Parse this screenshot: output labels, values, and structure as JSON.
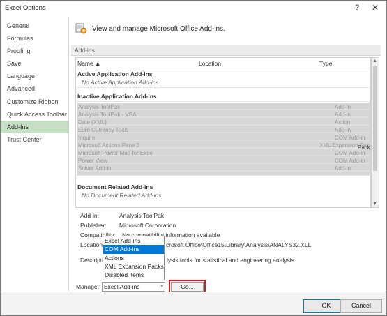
{
  "window": {
    "title": "Excel Options",
    "help": "?",
    "close": "✕"
  },
  "sidebar": {
    "items": [
      {
        "label": "General"
      },
      {
        "label": "Formulas"
      },
      {
        "label": "Proofing"
      },
      {
        "label": "Save"
      },
      {
        "label": "Language"
      },
      {
        "label": "Advanced"
      },
      {
        "label": "Customize Ribbon"
      },
      {
        "label": "Quick Access Toolbar"
      },
      {
        "label": "Add-Ins",
        "active": true
      },
      {
        "label": "Trust Center"
      }
    ]
  },
  "main": {
    "header": "View and manage Microsoft Office Add-ins.",
    "section": "Add-ins",
    "columns": {
      "name": "Name ▲",
      "location": "Location",
      "type": "Type"
    },
    "groups": {
      "active": "Active Application Add-ins",
      "active_empty": "No Active Application Add-ins",
      "inactive": "Inactive Application Add-ins",
      "document": "Document Related Add-ins",
      "document_empty": "No Document Related Add-ins"
    },
    "inactive_rows": [
      {
        "name": "Analysis ToolPak",
        "type": "Add-in"
      },
      {
        "name": "Analysis ToolPak - VBA",
        "type": "Add-in"
      },
      {
        "name": "Date (XML)",
        "type": "Action"
      },
      {
        "name": "Euro Currency Tools",
        "type": "Add-in"
      },
      {
        "name": "Inquire",
        "type": "COM Add-in"
      },
      {
        "name": "Microsoft Actions Pane 3",
        "type": "XML Expansion Pack"
      },
      {
        "name": "Microsoft Power Map for Excel",
        "type": "COM Add-in"
      },
      {
        "name": "Power View",
        "type": "COM Add-in"
      },
      {
        "name": "Solver Add-in",
        "type": "Add-in"
      }
    ],
    "pack_label": "Pack"
  },
  "details": {
    "addin_label": "Add-in:",
    "addin_value": "Analysis ToolPak",
    "publisher_label": "Publisher:",
    "publisher_value": "Microsoft Corporation",
    "compat_label": "Compatibility:",
    "compat_value": "No compatibility information available",
    "location_label": "Location:",
    "location_value": "crosoft Office\\Office15\\Library\\Analysis\\ANALYS32.XLL",
    "desc_label": "Description:",
    "desc_value": "lysis tools for statistical and engineering analysis"
  },
  "dropdown": {
    "options": [
      "Excel Add-ins",
      "COM Add-ins",
      "Actions",
      "XML Expansion Packs",
      "Disabled Items"
    ],
    "selected": "COM Add-ins"
  },
  "manage": {
    "label": "Manage:",
    "value": "Excel Add-ins",
    "go": "Go..."
  },
  "footer": {
    "ok": "OK",
    "cancel": "Cancel"
  },
  "colors": {
    "active_tab": "#c6e0c6",
    "highlight": "#0078d7",
    "go_outline": "#e0161f"
  }
}
